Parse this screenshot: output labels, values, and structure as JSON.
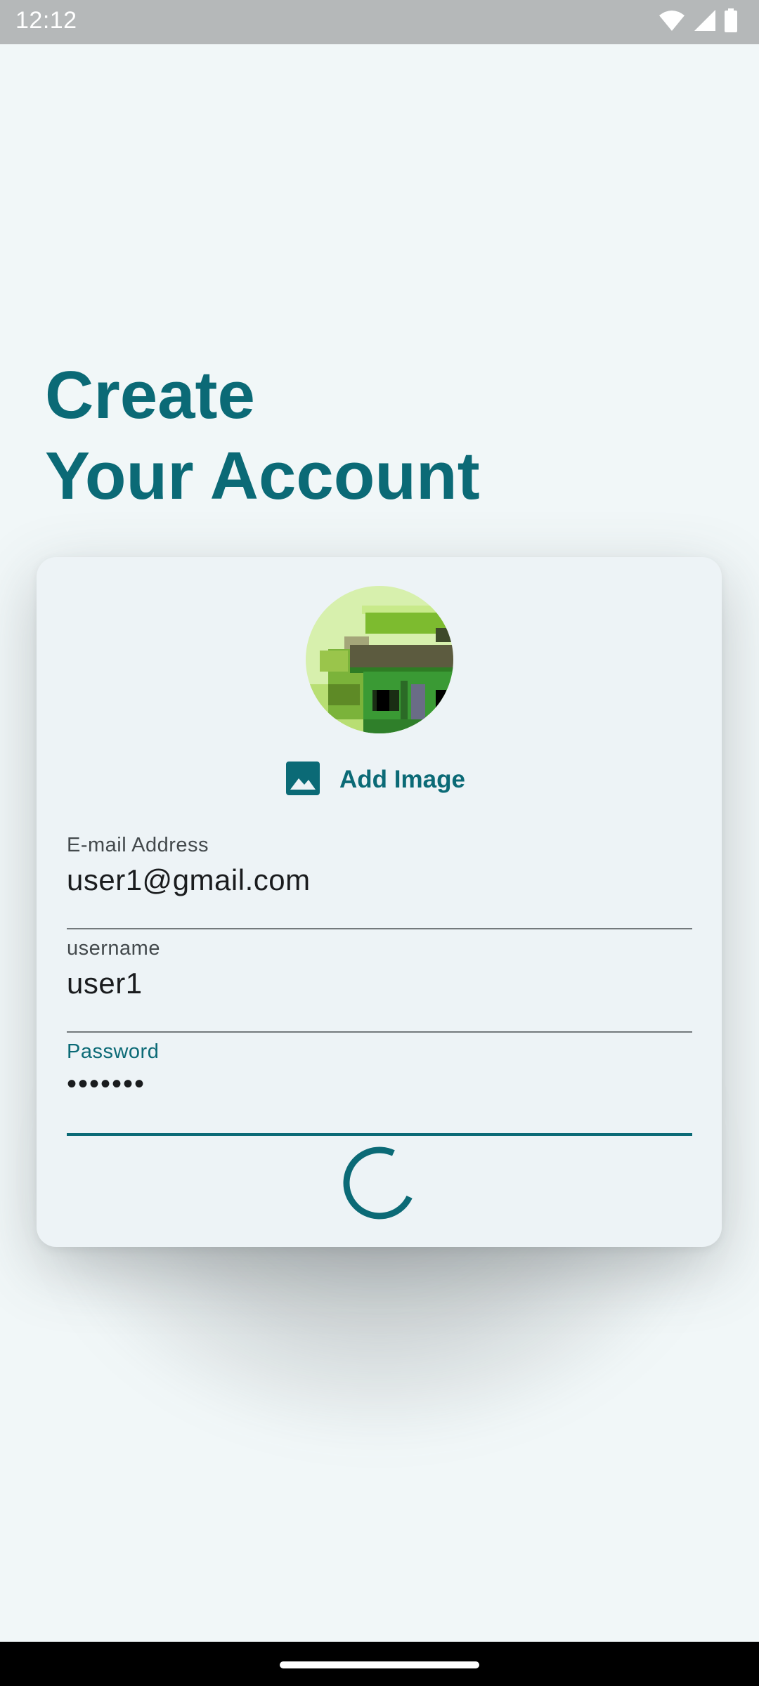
{
  "status_bar": {
    "time": "12:12",
    "icons": [
      "wifi-icon",
      "signal-icon",
      "battery-icon"
    ]
  },
  "title": {
    "line1": "Create",
    "line2": "Your Account"
  },
  "form": {
    "avatar_icon": "avatar-image",
    "add_image_label": "Add Image",
    "add_image_icon": "image-icon",
    "email": {
      "label": "E-mail Address",
      "value": "user1@gmail.com"
    },
    "username": {
      "label": "username",
      "value": "user1"
    },
    "password": {
      "label": "Password",
      "value": "•••••••"
    },
    "loading_indicator": "progress-spinner"
  },
  "colors": {
    "accent": "#0b6a76",
    "background": "#f1f7f8",
    "card": "#edf3f6"
  }
}
